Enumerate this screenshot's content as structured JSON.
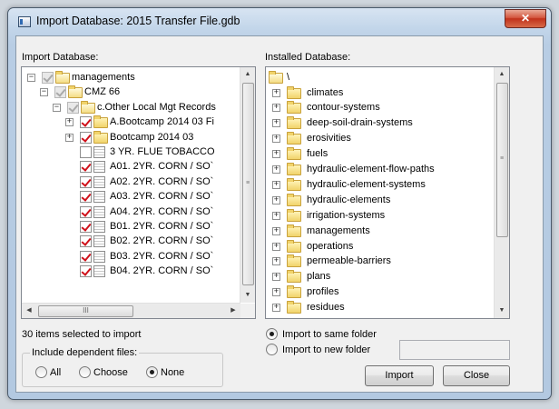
{
  "window": {
    "title": "Import Database: 2015 Transfer File.gdb",
    "close_glyph": "✕"
  },
  "left": {
    "label": "Import Database:",
    "items": [
      {
        "text": "managements",
        "level": 0,
        "expander": "⊟",
        "checked": true,
        "gray": true,
        "icon": "folder-open"
      },
      {
        "text": "CMZ 66",
        "level": 1,
        "expander": "⊟",
        "checked": true,
        "gray": true,
        "icon": "folder-open"
      },
      {
        "text": "c.Other Local Mgt Records",
        "level": 2,
        "expander": "⊟",
        "checked": true,
        "gray": true,
        "icon": "folder-open"
      },
      {
        "text": "A.Bootcamp 2014 03 Fi",
        "level": 3,
        "expander": "⊞",
        "checked": true,
        "gray": false,
        "icon": "folder"
      },
      {
        "text": "Bootcamp 2014 03",
        "level": 3,
        "expander": "⊞",
        "checked": true,
        "gray": false,
        "icon": "folder"
      },
      {
        "text": "3 YR. FLUE TOBACCO",
        "level": 3,
        "expander": "",
        "checked": false,
        "gray": false,
        "icon": "document"
      },
      {
        "text": "A01. 2YR. CORN / SO`",
        "level": 3,
        "expander": "",
        "checked": true,
        "gray": false,
        "icon": "document"
      },
      {
        "text": "A02. 2YR. CORN / SO`",
        "level": 3,
        "expander": "",
        "checked": true,
        "gray": false,
        "icon": "document"
      },
      {
        "text": "A03. 2YR. CORN / SO`",
        "level": 3,
        "expander": "",
        "checked": true,
        "gray": false,
        "icon": "document"
      },
      {
        "text": "A04. 2YR. CORN / SO`",
        "level": 3,
        "expander": "",
        "checked": true,
        "gray": false,
        "icon": "document"
      },
      {
        "text": "B01. 2YR. CORN / SO`",
        "level": 3,
        "expander": "",
        "checked": true,
        "gray": false,
        "icon": "document"
      },
      {
        "text": "B02. 2YR. CORN / SO`",
        "level": 3,
        "expander": "",
        "checked": true,
        "gray": false,
        "icon": "document"
      },
      {
        "text": "B03. 2YR. CORN / SO`",
        "level": 3,
        "expander": "",
        "checked": true,
        "gray": false,
        "icon": "document"
      },
      {
        "text": "B04. 2YR. CORN / SO`",
        "level": 3,
        "expander": "",
        "checked": true,
        "gray": false,
        "icon": "document"
      }
    ],
    "h_thumb_glyph": "III"
  },
  "right": {
    "label": "Installed Database:",
    "root": "\\",
    "items": [
      "climates",
      "contour-systems",
      "deep-soil-drain-systems",
      "erosivities",
      "fuels",
      "hydraulic-element-flow-paths",
      "hydraulic-element-systems",
      "hydraulic-elements",
      "irrigation-systems",
      "managements",
      "operations",
      "permeable-barriers",
      "plans",
      "profiles",
      "residues"
    ],
    "expander": "⊞"
  },
  "status": "30 items selected to import",
  "dependent": {
    "legend": "Include dependent files:",
    "options": [
      "All",
      "Choose",
      "None"
    ],
    "selected": "None"
  },
  "destination": {
    "options": [
      "Import to same folder",
      "Import to new folder"
    ],
    "selected": "Import to same folder",
    "new_folder_value": ""
  },
  "buttons": {
    "import": "Import",
    "close": "Close"
  },
  "scroll_glyphs": {
    "up": "▲",
    "down": "▼",
    "left": "◀",
    "right": "▶",
    "grip": "≡"
  }
}
